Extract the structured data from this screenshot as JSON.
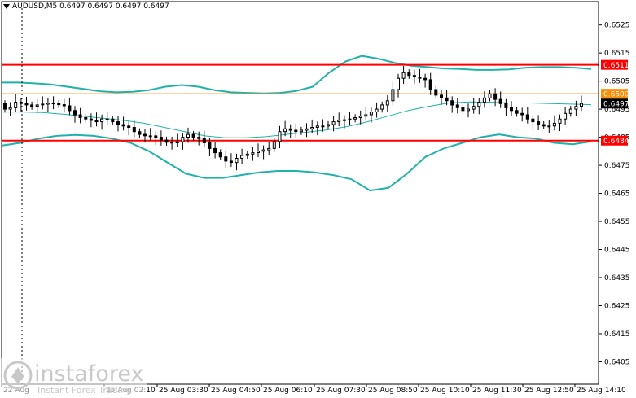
{
  "header": {
    "symbol": "AUDUSD,M5",
    "ohlc": "0.6497 0.6497 0.6497 0.6497"
  },
  "watermark": {
    "brand": "instaforex",
    "tagline": "Instant Forex Trading"
  },
  "colors": {
    "candle": "#000000",
    "bollinger": "#20b2aa",
    "level_support_resistance": "#ff0000",
    "level_pivot": "#ff8c00",
    "price_tag": "#000000",
    "grid_dotted": "#000000"
  },
  "chart_data": {
    "type": "candlestick",
    "grid": false,
    "y_axis": {
      "min": 0.6397,
      "max": 0.6531,
      "ticks": [
        "0.6525",
        "0.6515",
        "0.6505",
        "0.6495",
        "0.6485",
        "0.6475",
        "0.6465",
        "0.6455",
        "0.6445",
        "0.6435",
        "0.6425",
        "0.6415",
        "0.6405"
      ]
    },
    "x_axis": {
      "ticks": [
        "22 Aug",
        "25 Aug 02:10",
        "25 Aug 03:30",
        "25 Aug 04:50",
        "25 Aug 06:10",
        "25 Aug 07:30",
        "25 Aug 08:50",
        "25 Aug 10:10",
        "25 Aug 11:30",
        "25 Aug 12:50",
        "25 Aug 14:10"
      ]
    },
    "horizontal_levels": [
      {
        "label": "0.6511",
        "value": 0.65108,
        "color": "#ff0000"
      },
      {
        "label": "0.6500",
        "value": 0.65005,
        "color": "#ff8c00"
      },
      {
        "label": "0.6484",
        "value": 0.64838,
        "color": "#ff0000"
      }
    ],
    "current_price": {
      "label": "0.6497",
      "value": 0.6497
    },
    "close_path": [
      0.6495,
      0.64955,
      0.64975,
      0.6497,
      0.64965,
      0.6496,
      0.64965,
      0.64968,
      0.64972,
      0.6497,
      0.64966,
      0.64962,
      0.64945,
      0.6493,
      0.6492,
      0.64915,
      0.6491,
      0.64905,
      0.64915,
      0.64915,
      0.64905,
      0.64895,
      0.6489,
      0.64885,
      0.6487,
      0.6486,
      0.64855,
      0.64855,
      0.6485,
      0.6484,
      0.64832,
      0.6483,
      0.64834,
      0.6485,
      0.6486,
      0.6485,
      0.64845,
      0.6483,
      0.6481,
      0.64795,
      0.6478,
      0.64765,
      0.6476,
      0.64775,
      0.64785,
      0.6479,
      0.64795,
      0.648,
      0.64805,
      0.6481,
      0.64835,
      0.6487,
      0.6488,
      0.64875,
      0.6487,
      0.64875,
      0.6488,
      0.64885,
      0.6489,
      0.6489,
      0.64895,
      0.64905,
      0.6491,
      0.64912,
      0.64915,
      0.6492,
      0.64925,
      0.6493,
      0.6494,
      0.6495,
      0.64965,
      0.6498,
      0.6502,
      0.6506,
      0.6508,
      0.6507,
      0.65065,
      0.6506,
      0.65055,
      0.6502,
      0.65,
      0.6499,
      0.6498,
      0.64965,
      0.64955,
      0.64945,
      0.6495,
      0.6496,
      0.64975,
      0.6499,
      0.65005,
      0.64985,
      0.6497,
      0.64955,
      0.64945,
      0.64935,
      0.6493,
      0.64915,
      0.64905,
      0.64895,
      0.6489,
      0.6489,
      0.649,
      0.64915,
      0.64935,
      0.6495,
      0.6496,
      0.6497
    ],
    "bollinger_upper": [
      0.65045,
      0.65045,
      0.65042,
      0.65038,
      0.6503,
      0.65022,
      0.65014,
      0.6501,
      0.65012,
      0.65018,
      0.6503,
      0.65036,
      0.6503,
      0.65018,
      0.6501,
      0.65008,
      0.65006,
      0.65008,
      0.65015,
      0.6503,
      0.6508,
      0.6512,
      0.6514,
      0.6513,
      0.65115,
      0.65105,
      0.651,
      0.65095,
      0.65093,
      0.6509,
      0.6509,
      0.65092,
      0.65098,
      0.651,
      0.651,
      0.65098,
      0.65093
    ],
    "bollinger_lower": [
      0.6482,
      0.6483,
      0.64845,
      0.64855,
      0.64858,
      0.64855,
      0.64845,
      0.6483,
      0.648,
      0.6476,
      0.6472,
      0.64705,
      0.64705,
      0.64715,
      0.64725,
      0.6473,
      0.6473,
      0.64725,
      0.64715,
      0.647,
      0.6466,
      0.6467,
      0.6472,
      0.6478,
      0.6481,
      0.6483,
      0.6485,
      0.6486,
      0.6485,
      0.64845,
      0.6483,
      0.64825,
      0.64835
    ],
    "bollinger_middle": [
      0.6494,
      0.6494,
      0.64938,
      0.64932,
      0.64925,
      0.64918,
      0.6491,
      0.649,
      0.64885,
      0.6487,
      0.64855,
      0.64848,
      0.64848,
      0.64852,
      0.6486,
      0.64868,
      0.64876,
      0.64888,
      0.64905,
      0.64925,
      0.64945,
      0.6496,
      0.64972,
      0.64976,
      0.64975,
      0.64972,
      0.64972,
      0.6497,
      0.64968,
      0.64966
    ]
  }
}
